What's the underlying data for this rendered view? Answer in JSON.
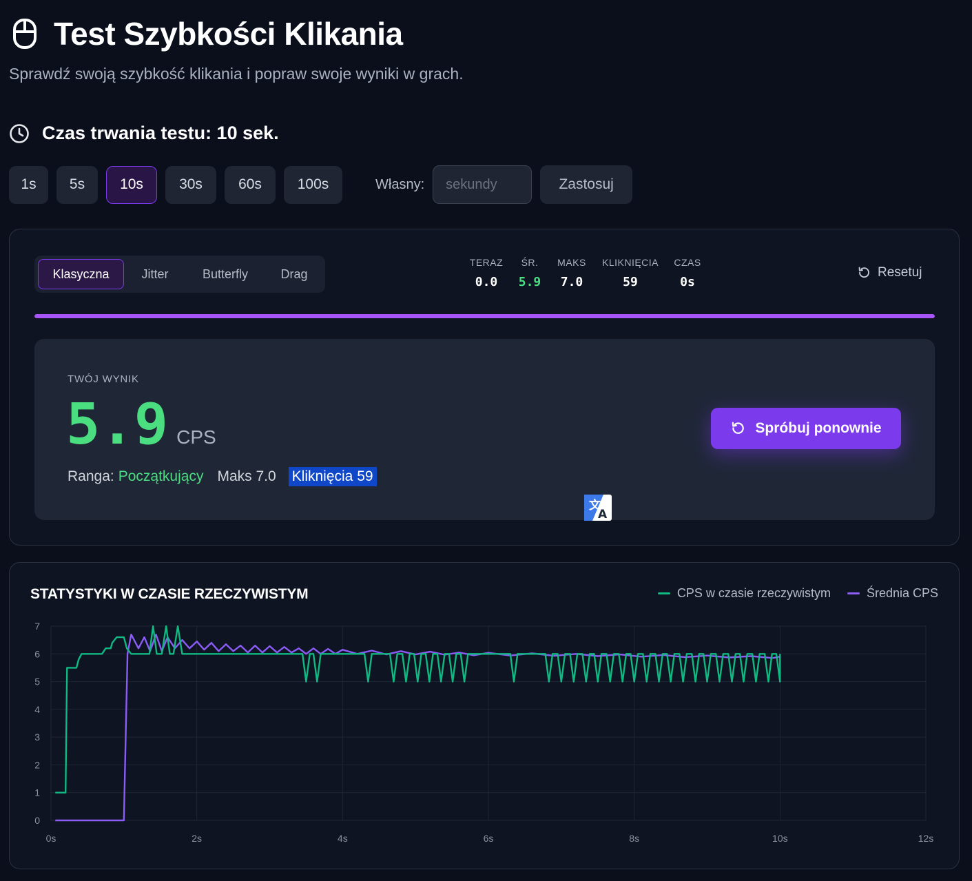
{
  "header": {
    "title": "Test Szybkości Klikania",
    "subtitle": "Sprawdź swoją szybkość klikania i popraw swoje wyniki w grach."
  },
  "duration": {
    "heading": "Czas trwania testu: 10 sek.",
    "options": [
      "1s",
      "5s",
      "10s",
      "30s",
      "60s",
      "100s"
    ],
    "selected": "10s",
    "custom_label": "Własny:",
    "custom_placeholder": "sekundy",
    "apply_label": "Zastosuj"
  },
  "modes": {
    "tabs": [
      "Klasyczna",
      "Jitter",
      "Butterfly",
      "Drag"
    ],
    "selected": "Klasyczna"
  },
  "stats": {
    "now_label": "TERAZ",
    "now_value": "0.0",
    "avg_label": "ŚR.",
    "avg_value": "5.9",
    "max_label": "MAKS",
    "max_value": "7.0",
    "clicks_label": "KLIKNIĘCIA",
    "clicks_value": "59",
    "time_label": "CZAS",
    "time_value": "0s"
  },
  "reset_label": "Resetuj",
  "progress": 1.0,
  "result": {
    "label": "TWÓJ WYNIK",
    "score": "5.9",
    "unit": "CPS",
    "rank_label": "Ranga:",
    "rank_value": "Początkujący",
    "max_text": "Maks 7.0",
    "clicks_text": "Kliknięcia 59",
    "retry_label": "Spróbuj ponownie"
  },
  "colors": {
    "accent": "#7c3aed",
    "green": "#4ade80",
    "realtime_line": "#10b981",
    "average_line": "#8b5cf6"
  },
  "icons": {
    "header": "mouse-icon",
    "duration": "clock-icon",
    "reset": "refresh-icon",
    "retry": "refresh-icon",
    "translate": "translate-icon"
  },
  "chart_data": {
    "type": "line",
    "title": "STATYSTYKI W CZASIE RZECZYWISTYM",
    "xlim": [
      0,
      12
    ],
    "ylim": [
      0,
      7
    ],
    "x_ticks": [
      0,
      2,
      4,
      6,
      8,
      10,
      12
    ],
    "x_tick_labels": [
      "0s",
      "2s",
      "4s",
      "6s",
      "8s",
      "10s",
      "12s"
    ],
    "y_ticks": [
      0,
      1,
      2,
      3,
      4,
      5,
      6,
      7
    ],
    "y_tick_labels": [
      "0",
      "1",
      "2",
      "3",
      "4",
      "5",
      "6",
      "7"
    ],
    "grid": true,
    "legend": "top-right",
    "series": [
      {
        "name": "CPS w czasie rzeczywistym",
        "points": [
          [
            0.06,
            1
          ],
          [
            0.2,
            1
          ],
          [
            0.22,
            5.5
          ],
          [
            0.35,
            5.5
          ],
          [
            0.38,
            5.8
          ],
          [
            0.42,
            6
          ],
          [
            0.6,
            6
          ],
          [
            0.62,
            6
          ],
          [
            0.7,
            6
          ],
          [
            0.75,
            6.2
          ],
          [
            0.82,
            6.2
          ],
          [
            0.84,
            6.4
          ],
          [
            0.9,
            6.6
          ],
          [
            1.0,
            6.6
          ],
          [
            1.04,
            6.2
          ],
          [
            1.1,
            6
          ],
          [
            1.35,
            6
          ],
          [
            1.4,
            7
          ],
          [
            1.45,
            6
          ],
          [
            1.52,
            6
          ],
          [
            1.58,
            7
          ],
          [
            1.63,
            6
          ],
          [
            1.68,
            6
          ],
          [
            1.74,
            7
          ],
          [
            1.8,
            6
          ],
          [
            3.45,
            6
          ],
          [
            3.5,
            5
          ],
          [
            3.55,
            6
          ],
          [
            3.6,
            6
          ],
          [
            3.65,
            5
          ],
          [
            3.7,
            6
          ],
          [
            4.3,
            6
          ],
          [
            4.35,
            5
          ],
          [
            4.4,
            6
          ],
          [
            4.65,
            6
          ],
          [
            4.7,
            5
          ],
          [
            4.75,
            6
          ],
          [
            4.82,
            6
          ],
          [
            4.87,
            5
          ],
          [
            4.92,
            6
          ],
          [
            4.98,
            6
          ],
          [
            5.03,
            5
          ],
          [
            5.08,
            6
          ],
          [
            5.14,
            6
          ],
          [
            5.19,
            5
          ],
          [
            5.24,
            6
          ],
          [
            5.3,
            6
          ],
          [
            5.35,
            5
          ],
          [
            5.4,
            6
          ],
          [
            5.46,
            6
          ],
          [
            5.51,
            5
          ],
          [
            5.56,
            6
          ],
          [
            5.62,
            6
          ],
          [
            5.67,
            5
          ],
          [
            5.72,
            6
          ],
          [
            6.3,
            6
          ],
          [
            6.35,
            5
          ],
          [
            6.4,
            6
          ],
          [
            6.78,
            6
          ],
          [
            6.83,
            5
          ],
          [
            6.88,
            6
          ],
          [
            6.95,
            6
          ],
          [
            7.0,
            5
          ],
          [
            7.05,
            6
          ],
          [
            7.12,
            6
          ],
          [
            7.17,
            5
          ],
          [
            7.22,
            6
          ],
          [
            7.29,
            6
          ],
          [
            7.34,
            5
          ],
          [
            7.39,
            6
          ],
          [
            7.45,
            6
          ],
          [
            7.5,
            5
          ],
          [
            7.55,
            6
          ],
          [
            7.62,
            6
          ],
          [
            7.67,
            5
          ],
          [
            7.72,
            6
          ],
          [
            7.79,
            6
          ],
          [
            7.84,
            5
          ],
          [
            7.89,
            6
          ],
          [
            7.95,
            6
          ],
          [
            8.0,
            5
          ],
          [
            8.05,
            6
          ],
          [
            8.12,
            6
          ],
          [
            8.17,
            5
          ],
          [
            8.22,
            6
          ],
          [
            8.29,
            6
          ],
          [
            8.34,
            5
          ],
          [
            8.39,
            6
          ],
          [
            8.45,
            6
          ],
          [
            8.5,
            5
          ],
          [
            8.55,
            6
          ],
          [
            8.62,
            6
          ],
          [
            8.67,
            5
          ],
          [
            8.72,
            6
          ],
          [
            8.79,
            6
          ],
          [
            8.84,
            5
          ],
          [
            8.89,
            6
          ],
          [
            8.95,
            6
          ],
          [
            9.0,
            5
          ],
          [
            9.05,
            6
          ],
          [
            9.12,
            6
          ],
          [
            9.17,
            5
          ],
          [
            9.22,
            6
          ],
          [
            9.29,
            6
          ],
          [
            9.34,
            5
          ],
          [
            9.39,
            6
          ],
          [
            9.45,
            6
          ],
          [
            9.5,
            5
          ],
          [
            9.55,
            6
          ],
          [
            9.62,
            6
          ],
          [
            9.67,
            5
          ],
          [
            9.72,
            6
          ],
          [
            9.79,
            6
          ],
          [
            9.84,
            5
          ],
          [
            9.89,
            6
          ],
          [
            9.95,
            6
          ],
          [
            10.0,
            5
          ],
          [
            10.0,
            6
          ]
        ]
      },
      {
        "name": "Średnia CPS",
        "points": [
          [
            0.06,
            0
          ],
          [
            1.0,
            0
          ],
          [
            1.05,
            6.0
          ],
          [
            1.1,
            6.7
          ],
          [
            1.2,
            6.2
          ],
          [
            1.28,
            6.6
          ],
          [
            1.36,
            6.1
          ],
          [
            1.44,
            6.7
          ],
          [
            1.52,
            6.1
          ],
          [
            1.6,
            6.6
          ],
          [
            1.7,
            6.2
          ],
          [
            1.8,
            6.5
          ],
          [
            1.9,
            6.2
          ],
          [
            2.0,
            6.45
          ],
          [
            2.1,
            6.15
          ],
          [
            2.2,
            6.4
          ],
          [
            2.3,
            6.1
          ],
          [
            2.4,
            6.35
          ],
          [
            2.5,
            6.1
          ],
          [
            2.6,
            6.3
          ],
          [
            2.7,
            6.05
          ],
          [
            2.8,
            6.3
          ],
          [
            2.9,
            6.05
          ],
          [
            3.0,
            6.28
          ],
          [
            3.1,
            6.05
          ],
          [
            3.2,
            6.25
          ],
          [
            3.3,
            6.05
          ],
          [
            3.4,
            6.2
          ],
          [
            3.5,
            6.0
          ],
          [
            3.6,
            6.2
          ],
          [
            3.7,
            6.0
          ],
          [
            3.8,
            6.18
          ],
          [
            3.9,
            6.0
          ],
          [
            4.0,
            6.15
          ],
          [
            4.2,
            6.0
          ],
          [
            4.4,
            6.12
          ],
          [
            4.6,
            5.98
          ],
          [
            4.8,
            6.1
          ],
          [
            5.0,
            5.98
          ],
          [
            5.2,
            6.08
          ],
          [
            5.4,
            5.97
          ],
          [
            5.6,
            6.05
          ],
          [
            5.8,
            5.95
          ],
          [
            6.0,
            6.04
          ],
          [
            6.3,
            5.94
          ],
          [
            6.6,
            6.02
          ],
          [
            6.9,
            5.93
          ],
          [
            7.2,
            6.0
          ],
          [
            7.5,
            5.92
          ],
          [
            7.8,
            5.98
          ],
          [
            8.1,
            5.9
          ],
          [
            8.4,
            5.96
          ],
          [
            8.7,
            5.88
          ],
          [
            9.0,
            5.94
          ],
          [
            9.3,
            5.87
          ],
          [
            9.6,
            5.92
          ],
          [
            9.9,
            5.85
          ],
          [
            10.0,
            5.9
          ]
        ]
      }
    ]
  }
}
